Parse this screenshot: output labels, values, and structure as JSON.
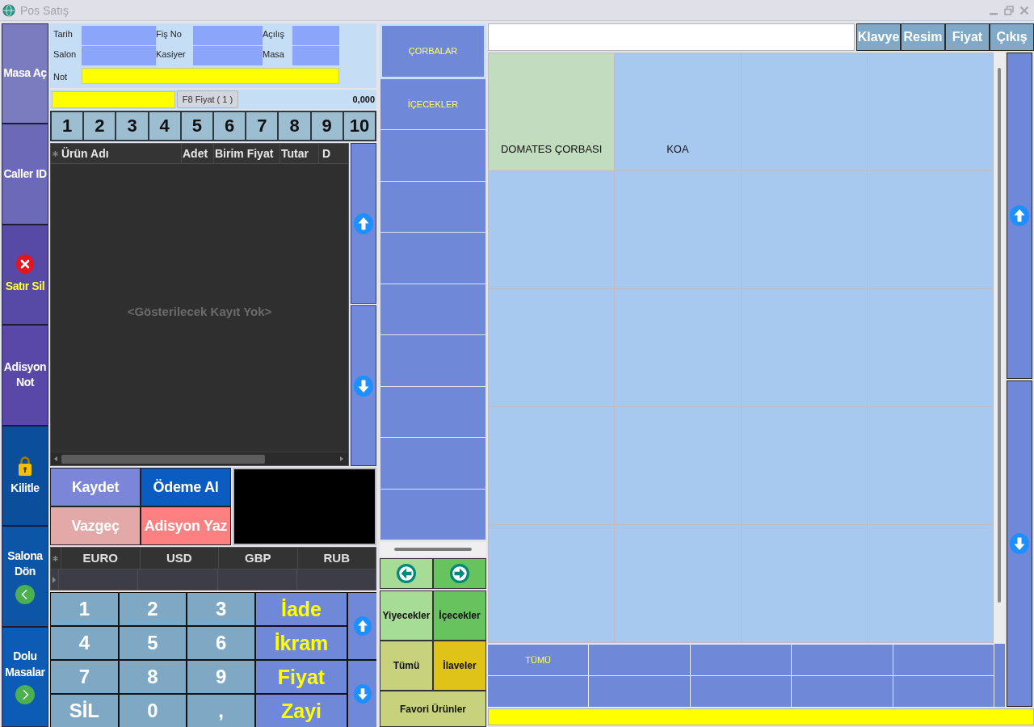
{
  "window": {
    "title": "Pos Satış"
  },
  "side_menu": [
    {
      "label": "Masa Aç",
      "kind": "plain"
    },
    {
      "label": "Caller ID",
      "kind": "plain"
    },
    {
      "label": "Satır Sil",
      "kind": "delete"
    },
    {
      "label": "Adisyon Not",
      "kind": "plain"
    },
    {
      "label": "Kilitle",
      "kind": "lock"
    },
    {
      "label": "Salona Dön",
      "kind": "back"
    },
    {
      "label": "Dolu Masalar",
      "kind": "forward"
    }
  ],
  "info_fields": [
    {
      "label": "Tarih"
    },
    {
      "label": "Fiş No"
    },
    {
      "label": "Açılış"
    },
    {
      "label": "Salon"
    },
    {
      "label": "Kasiyer"
    },
    {
      "label": "Masa"
    }
  ],
  "note": {
    "label": "Not"
  },
  "price_bar": {
    "button": "F8 Fiyat ( 1 )",
    "total": "0,000"
  },
  "number_tabs": [
    "1",
    "2",
    "3",
    "4",
    "5",
    "6",
    "7",
    "8",
    "9",
    "10"
  ],
  "order_grid": {
    "columns": [
      "Ürün Adı",
      "Adet",
      "Birim Fiyat",
      "Tutar",
      "D"
    ],
    "empty_text": "<Gösterilecek Kayıt Yok>"
  },
  "actions": [
    "Kaydet",
    "Ödeme Al",
    "Vazgeç",
    "Adisyon Yaz"
  ],
  "currency_grid": {
    "columns": [
      "EURO",
      "USD",
      "GBP",
      "RUB"
    ]
  },
  "keypad": {
    "keys": [
      "1",
      "2",
      "3",
      "4",
      "5",
      "6",
      "7",
      "8",
      "9",
      "SİL",
      "0",
      ","
    ],
    "functions": [
      "İade",
      "İkram",
      "Fiyat",
      "Zayi"
    ]
  },
  "categories": [
    {
      "label": "ÇORBALAR",
      "selected": true
    },
    {
      "label": "İÇECEKLER",
      "selected": false
    }
  ],
  "group_buttons": [
    {
      "label": "Yiyecekler",
      "color": "#a6dc95"
    },
    {
      "label": "İçecekler",
      "color": "#66c35e"
    },
    {
      "label": "Tümü",
      "color": "#c8d27c"
    },
    {
      "label": "İlaveler",
      "color": "#dfc318"
    },
    {
      "label": "Favori Ürünler",
      "color": "#c8d27c"
    }
  ],
  "toolbar_buttons": [
    "Klavye",
    "Resim",
    "Fiyat",
    "Çıkış"
  ],
  "products": [
    {
      "name": "DOMATES ÇORBASI",
      "color": "#c1dcbf"
    },
    {
      "name": "KOA",
      "color": "#a8c9ef"
    }
  ],
  "subcategories": [
    {
      "label": "TÜMÜ"
    }
  ]
}
